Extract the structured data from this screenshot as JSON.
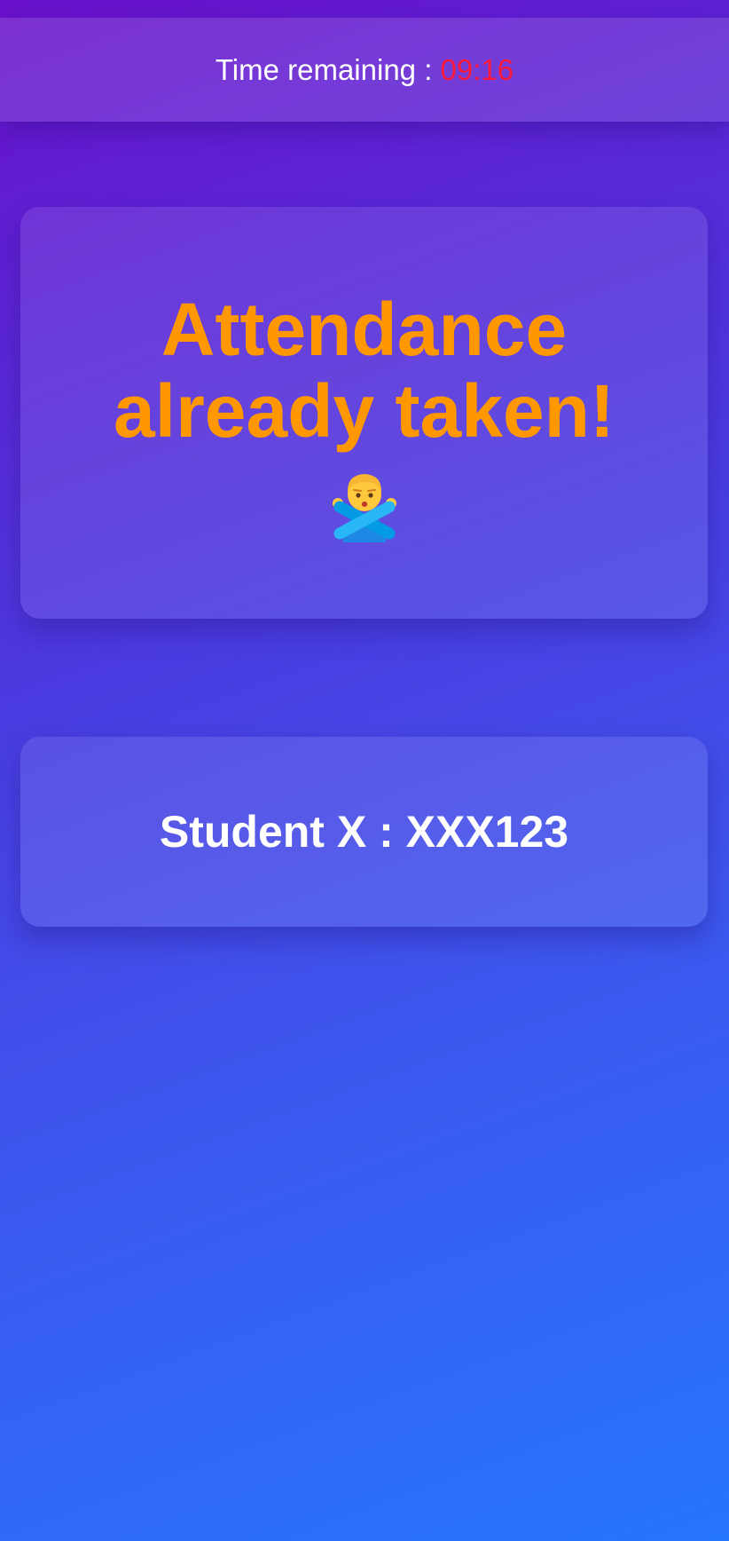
{
  "timer": {
    "label": "Time remaining : ",
    "value": "09:16",
    "value_color": "#ff1a3c"
  },
  "status_card": {
    "heading_line1": "Attendance",
    "heading_line2": "already taken!",
    "heading_color": "#ff9800",
    "emoji_icon": "person-gesturing-no-icon"
  },
  "student_card": {
    "student_label": "Student X : XXX123"
  },
  "colors": {
    "background_start": "#6a11cb",
    "background_end": "#2575fc"
  }
}
